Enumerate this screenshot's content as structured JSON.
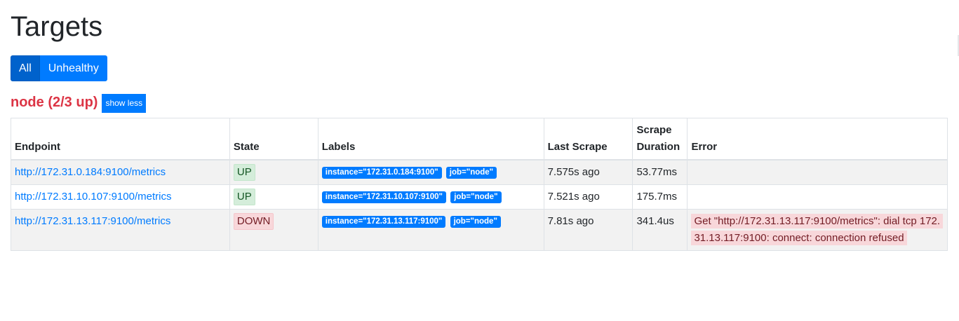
{
  "page": {
    "title": "Targets"
  },
  "filters": {
    "all_label": "All",
    "unhealthy_label": "Unhealthy"
  },
  "job": {
    "heading": "node (2/3 up)",
    "toggle_label": "show less"
  },
  "table": {
    "headers": {
      "endpoint": "Endpoint",
      "state": "State",
      "labels": "Labels",
      "last_scrape": "Last Scrape",
      "scrape_duration": "Scrape Duration",
      "error": "Error"
    },
    "rows": [
      {
        "endpoint": "http://172.31.0.184:9100/metrics",
        "state": "UP",
        "labels": [
          "instance=\"172.31.0.184:9100\"",
          "job=\"node\""
        ],
        "last_scrape": "7.575s ago",
        "scrape_duration": "53.77ms",
        "error": ""
      },
      {
        "endpoint": "http://172.31.10.107:9100/metrics",
        "state": "UP",
        "labels": [
          "instance=\"172.31.10.107:9100\"",
          "job=\"node\""
        ],
        "last_scrape": "7.521s ago",
        "scrape_duration": "175.7ms",
        "error": ""
      },
      {
        "endpoint": "http://172.31.13.117:9100/metrics",
        "state": "DOWN",
        "labels": [
          "instance=\"172.31.13.117:9100\"",
          "job=\"node\""
        ],
        "last_scrape": "7.81s ago",
        "scrape_duration": "341.4us",
        "error": "Get \"http://172.31.13.117:9100/metrics\": dial tcp 172.31.13.117:9100: connect: connection refused"
      }
    ]
  },
  "colors": {
    "primary": "#007bff",
    "primary_active": "#0062cc",
    "job_heading": "#dc3545",
    "state_up_bg": "#d4edda",
    "state_down_bg": "#f8d7da"
  }
}
